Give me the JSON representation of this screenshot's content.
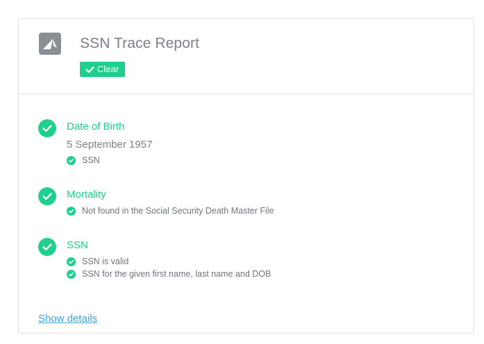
{
  "report": {
    "title": "SSN Trace Report",
    "status_badge": "Clear",
    "status_color": "#1ecf8d",
    "logo_icon": "app-logo-icon"
  },
  "sections": {
    "dob": {
      "title": "Date of Birth",
      "value": "5 September 1957",
      "checks": [
        "SSN"
      ]
    },
    "mortality": {
      "title": "Mortality",
      "checks": [
        "Not found in the Social Security Death Master File"
      ]
    },
    "ssn": {
      "title": "SSN",
      "checks": [
        "SSN is valid",
        "SSN for the given first name, last name and DOB"
      ]
    }
  },
  "footer": {
    "show_details_label": "Show details",
    "link_color": "#3ea0d8"
  }
}
